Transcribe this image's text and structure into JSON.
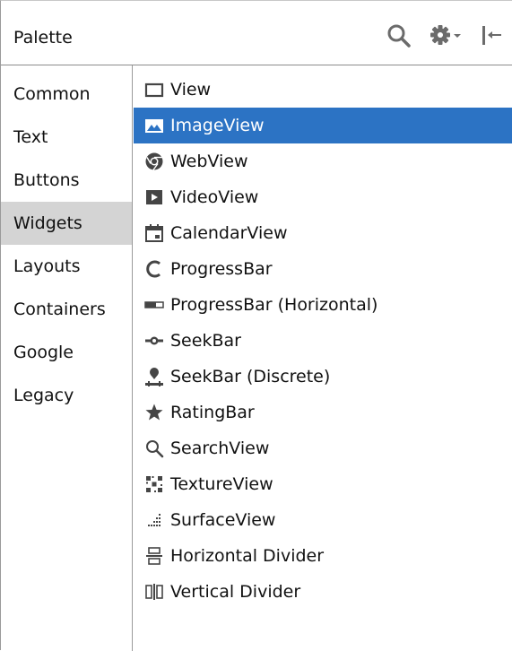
{
  "palette": {
    "title": "Palette",
    "toolbar_icons": [
      "search-icon",
      "gear-dropdown-icon",
      "collapse-panel-icon"
    ]
  },
  "categories": [
    {
      "label": "Common",
      "selected": false
    },
    {
      "label": "Text",
      "selected": false
    },
    {
      "label": "Buttons",
      "selected": false
    },
    {
      "label": "Widgets",
      "selected": true
    },
    {
      "label": "Layouts",
      "selected": false
    },
    {
      "label": "Containers",
      "selected": false
    },
    {
      "label": "Google",
      "selected": false
    },
    {
      "label": "Legacy",
      "selected": false
    }
  ],
  "items": [
    {
      "label": "View",
      "icon": "view-icon",
      "selected": false
    },
    {
      "label": "ImageView",
      "icon": "imageview-icon",
      "selected": true
    },
    {
      "label": "WebView",
      "icon": "webview-icon",
      "selected": false
    },
    {
      "label": "VideoView",
      "icon": "videoview-icon",
      "selected": false
    },
    {
      "label": "CalendarView",
      "icon": "calendarview-icon",
      "selected": false
    },
    {
      "label": "ProgressBar",
      "icon": "progressbar-icon",
      "selected": false
    },
    {
      "label": "ProgressBar (Horizontal)",
      "icon": "progressbar-horizontal-icon",
      "selected": false
    },
    {
      "label": "SeekBar",
      "icon": "seekbar-icon",
      "selected": false
    },
    {
      "label": "SeekBar (Discrete)",
      "icon": "seekbar-discrete-icon",
      "selected": false
    },
    {
      "label": "RatingBar",
      "icon": "ratingbar-icon",
      "selected": false
    },
    {
      "label": "SearchView",
      "icon": "searchview-icon",
      "selected": false
    },
    {
      "label": "TextureView",
      "icon": "textureview-icon",
      "selected": false
    },
    {
      "label": "SurfaceView",
      "icon": "surfaceview-icon",
      "selected": false
    },
    {
      "label": "Horizontal Divider",
      "icon": "horizontal-divider-icon",
      "selected": false
    },
    {
      "label": "Vertical Divider",
      "icon": "vertical-divider-icon",
      "selected": false
    }
  ],
  "colors": {
    "selection": "#2c73c4",
    "category_selection": "#d4d4d4",
    "icon": "#454545"
  }
}
